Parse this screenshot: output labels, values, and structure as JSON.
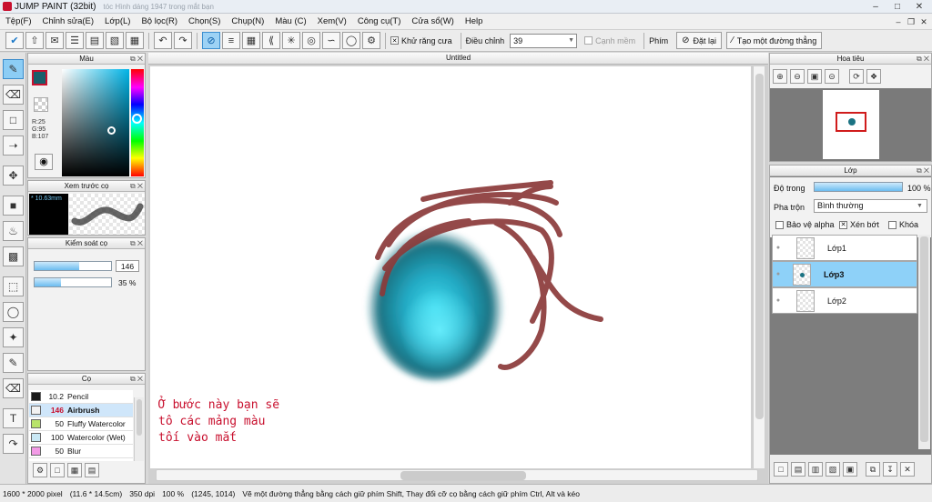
{
  "window": {
    "title": "JUMP PAINT (32bit)",
    "ghost_text": "tóc   Hình dáng 1947   trong mắt bạn"
  },
  "menu": [
    "Tệp(F)",
    "Chỉnh sửa(E)",
    "Lớp(L)",
    "Bộ lọc(R)",
    "Chọn(S)",
    "Chụp(N)",
    "Màu (C)",
    "Xem(V)",
    "Công cụ(T)",
    "Cửa sổ(W)",
    "Help"
  ],
  "toolbar": {
    "antialias_label": "Khử răng cưa",
    "antialias_checked": true,
    "adjust_label": "Điều chỉnh",
    "adjust_value": "39",
    "sharp_label": "Cạnh mềm",
    "key_label": "Phím",
    "reset_label": "Đặt lại",
    "line_label": "Tạo một đường thẳng"
  },
  "color_panel": {
    "title": "Màu",
    "r": "R:25",
    "g": "G:95",
    "b": "B:107",
    "current_color": "#195f6b"
  },
  "preview_panel": {
    "title": "Xem trước cọ",
    "size": "* 10.63mm"
  },
  "control_panel": {
    "title": "Kiểm soát cọ",
    "size_value": "146",
    "size_fraction": 0.58,
    "opacity_value": "35 %",
    "opacity_fraction": 0.35
  },
  "brush_panel": {
    "title": "Cọ",
    "items": [
      {
        "size": "10.2",
        "name": "Pencil",
        "color": "#1a1a1a",
        "selected": false
      },
      {
        "size": "146",
        "name": "Airbrush",
        "color": "#f2f2f2",
        "selected": true
      },
      {
        "size": "50",
        "name": "Fluffy Watercolor",
        "color": "#b8e36a",
        "selected": false
      },
      {
        "size": "100",
        "name": "Watercolor (Wet)",
        "color": "#c9e8f5",
        "selected": false
      },
      {
        "size": "50",
        "name": "Blur",
        "color": "#f29ae6",
        "selected": false
      }
    ]
  },
  "document": {
    "tab_title": "Untitled",
    "note": "Ở bước này bạn sẽ\ntô các mảng màu\ntối vào mắt"
  },
  "navigator": {
    "title": "Hoa tiêu"
  },
  "layer_panel": {
    "title": "Lớp",
    "opacity_label": "Độ trong",
    "opacity_value": "100 %",
    "opacity_fraction": 1.0,
    "blend_label": "Pha trộn",
    "blend_value": "Bình thường",
    "protect_alpha": "Bảo vệ alpha",
    "clip": "Xén bớt",
    "lock": "Khóa",
    "layers": [
      {
        "name": "Lớp1",
        "selected": false
      },
      {
        "name": "Lớp3",
        "selected": true
      },
      {
        "name": "Lớp2",
        "selected": false
      }
    ]
  },
  "status": {
    "size": "1600 * 2000 pixel",
    "cm": "(11.6 * 14.5cm)",
    "dpi": "350 dpi",
    "zoom": "100 %",
    "coords": "(1245, 1014)",
    "hint": "Vẽ một đường thẳng bằng cách giữ phím Shift, Thay đổi cỡ cọ bằng cách giữ phím Ctrl, Alt và kéo"
  }
}
